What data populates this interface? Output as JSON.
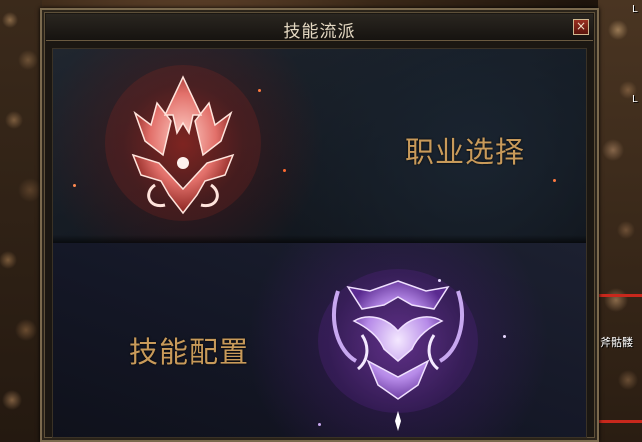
{
  "window": {
    "title": "技能流派",
    "close_glyph": "×"
  },
  "panels": {
    "class_selection": {
      "label": "职业选择",
      "icon": "red-crest-icon"
    },
    "skill_config": {
      "label": "技能配置",
      "icon": "purple-crest-icon"
    }
  },
  "background": {
    "npc_name": "斧骷髅",
    "edge_labels": [
      "L",
      "L"
    ]
  },
  "colors": {
    "label_gold": "#c89a5a",
    "title_text": "#e4d8c2",
    "red_emblem": "#d8504a",
    "purple_emblem": "#9a6ad8",
    "hp_bar": "#c8281c"
  }
}
